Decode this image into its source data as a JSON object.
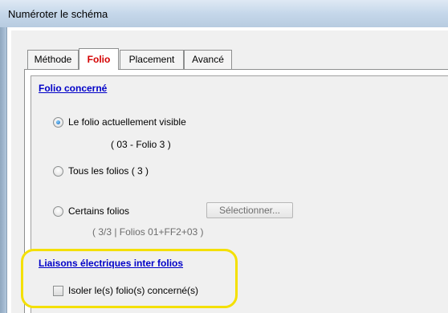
{
  "window": {
    "title": "Numéroter le schéma"
  },
  "tabs": [
    {
      "label": "Méthode",
      "active": false
    },
    {
      "label": "Folio",
      "active": true
    },
    {
      "label": "Placement",
      "active": false
    },
    {
      "label": "Avancé",
      "active": false
    }
  ],
  "folio_section": {
    "title": "Folio concerné",
    "options": [
      {
        "label": "Le folio actuellement visible",
        "selected": true,
        "detail": "( 03 - Folio 3 )"
      },
      {
        "label": "Tous les folios ( 3 )",
        "selected": false
      },
      {
        "label": "Certains folios",
        "selected": false,
        "detail": "( 3/3  |  Folios 01+FF2+03 )"
      }
    ],
    "select_button": "Sélectionner..."
  },
  "links_section": {
    "title": "Liaisons électriques inter folios",
    "checkbox_label": "Isoler le(s) folio(s) concerné(s)",
    "checked": false
  },
  "colors": {
    "active_tab": "#d40000",
    "section_title": "#0000c8",
    "highlight": "#f4e000"
  }
}
